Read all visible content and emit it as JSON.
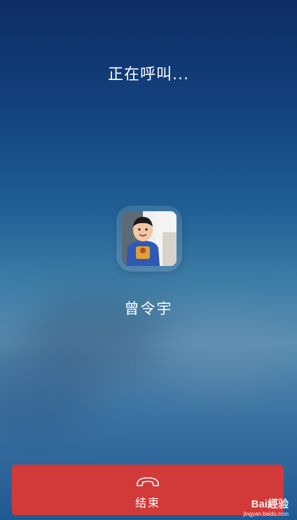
{
  "call": {
    "status": "正在呼叫...",
    "contact_name": "曾令宇"
  },
  "end_button": {
    "label": "结束",
    "icon": "phone-hangup-icon",
    "color": "#d23a3a"
  },
  "watermark": {
    "logo": "Bai經验",
    "url": "jingyan.baidu.com"
  }
}
